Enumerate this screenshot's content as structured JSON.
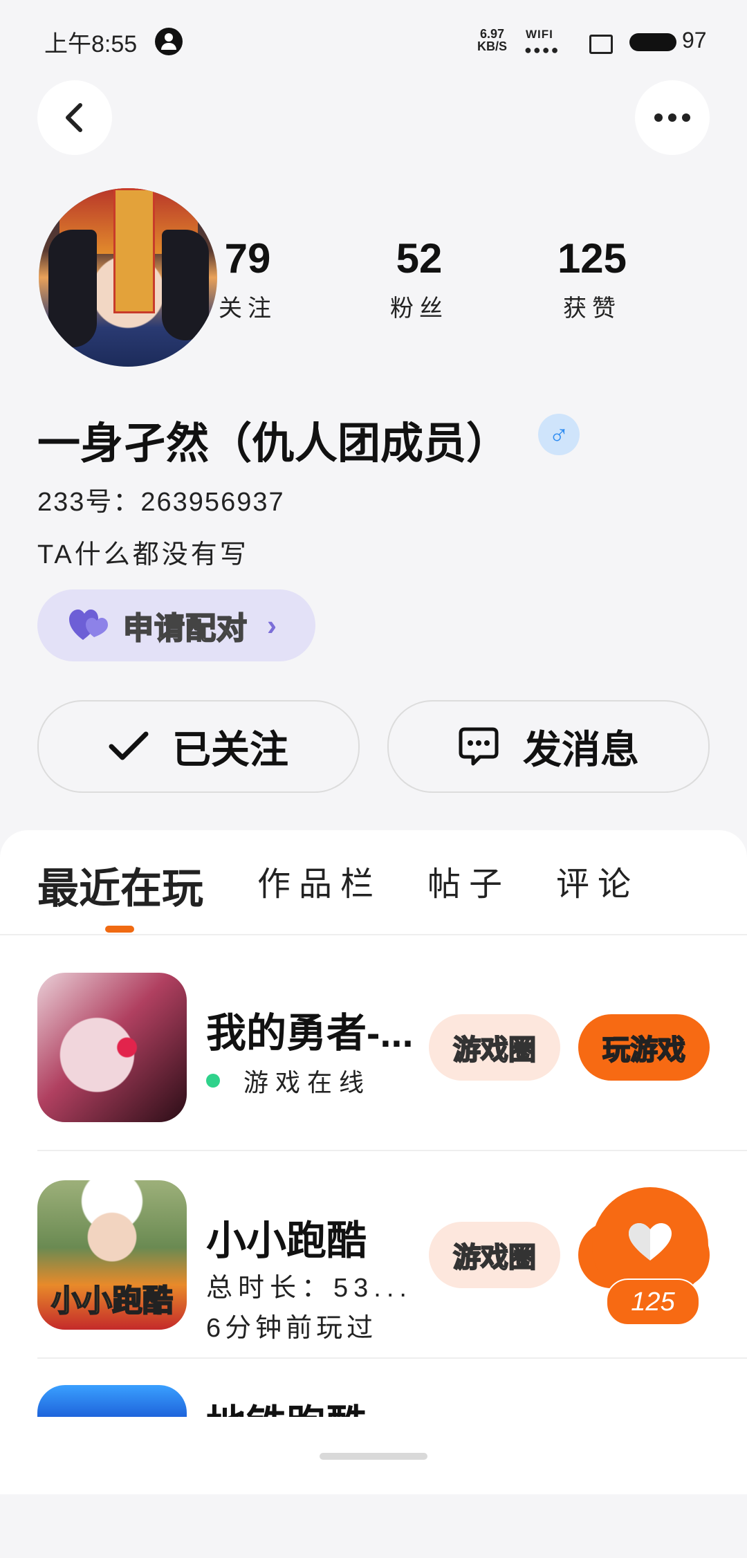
{
  "status_bar": {
    "time": "上午8:55",
    "net_speed_value": "6.97",
    "net_speed_unit": "KB/S",
    "wifi_label": "WIFI",
    "battery_level": "97"
  },
  "profile": {
    "stats": [
      {
        "value": "79",
        "label": "关注"
      },
      {
        "value": "52",
        "label": "粉丝"
      },
      {
        "value": "125",
        "label": "获赞"
      }
    ],
    "name": "一身孑然（仇人团成员）",
    "gender_symbol": "♂",
    "uid": "233号：263956937",
    "bio": "TA什么都没有写",
    "pair_label": "申请配对",
    "follow_label": "已关注",
    "message_label": "发消息"
  },
  "tabs": [
    {
      "label": "最近在玩",
      "active": true
    },
    {
      "label": "作品栏",
      "active": false
    },
    {
      "label": "帖子",
      "active": false
    },
    {
      "label": "评论",
      "active": false
    }
  ],
  "games": [
    {
      "title": "我的勇者-...",
      "status": "游戏在线",
      "circle_label": "游戏圈",
      "play_label": "玩游戏"
    },
    {
      "title": "小小跑酷",
      "icon_text": "小小跑酷",
      "meta_duration": "总时长：53...",
      "meta_last": "6分钟前玩过",
      "circle_label": "游戏圈"
    },
    {
      "title": "地铁跑酷"
    }
  ],
  "like_fab": {
    "count": "125"
  },
  "colors": {
    "accent_orange": "#f76a13",
    "online_green": "#2fd28b",
    "pair_bg": "#e3e1f7",
    "gender_blue": "#2f8cf1"
  }
}
